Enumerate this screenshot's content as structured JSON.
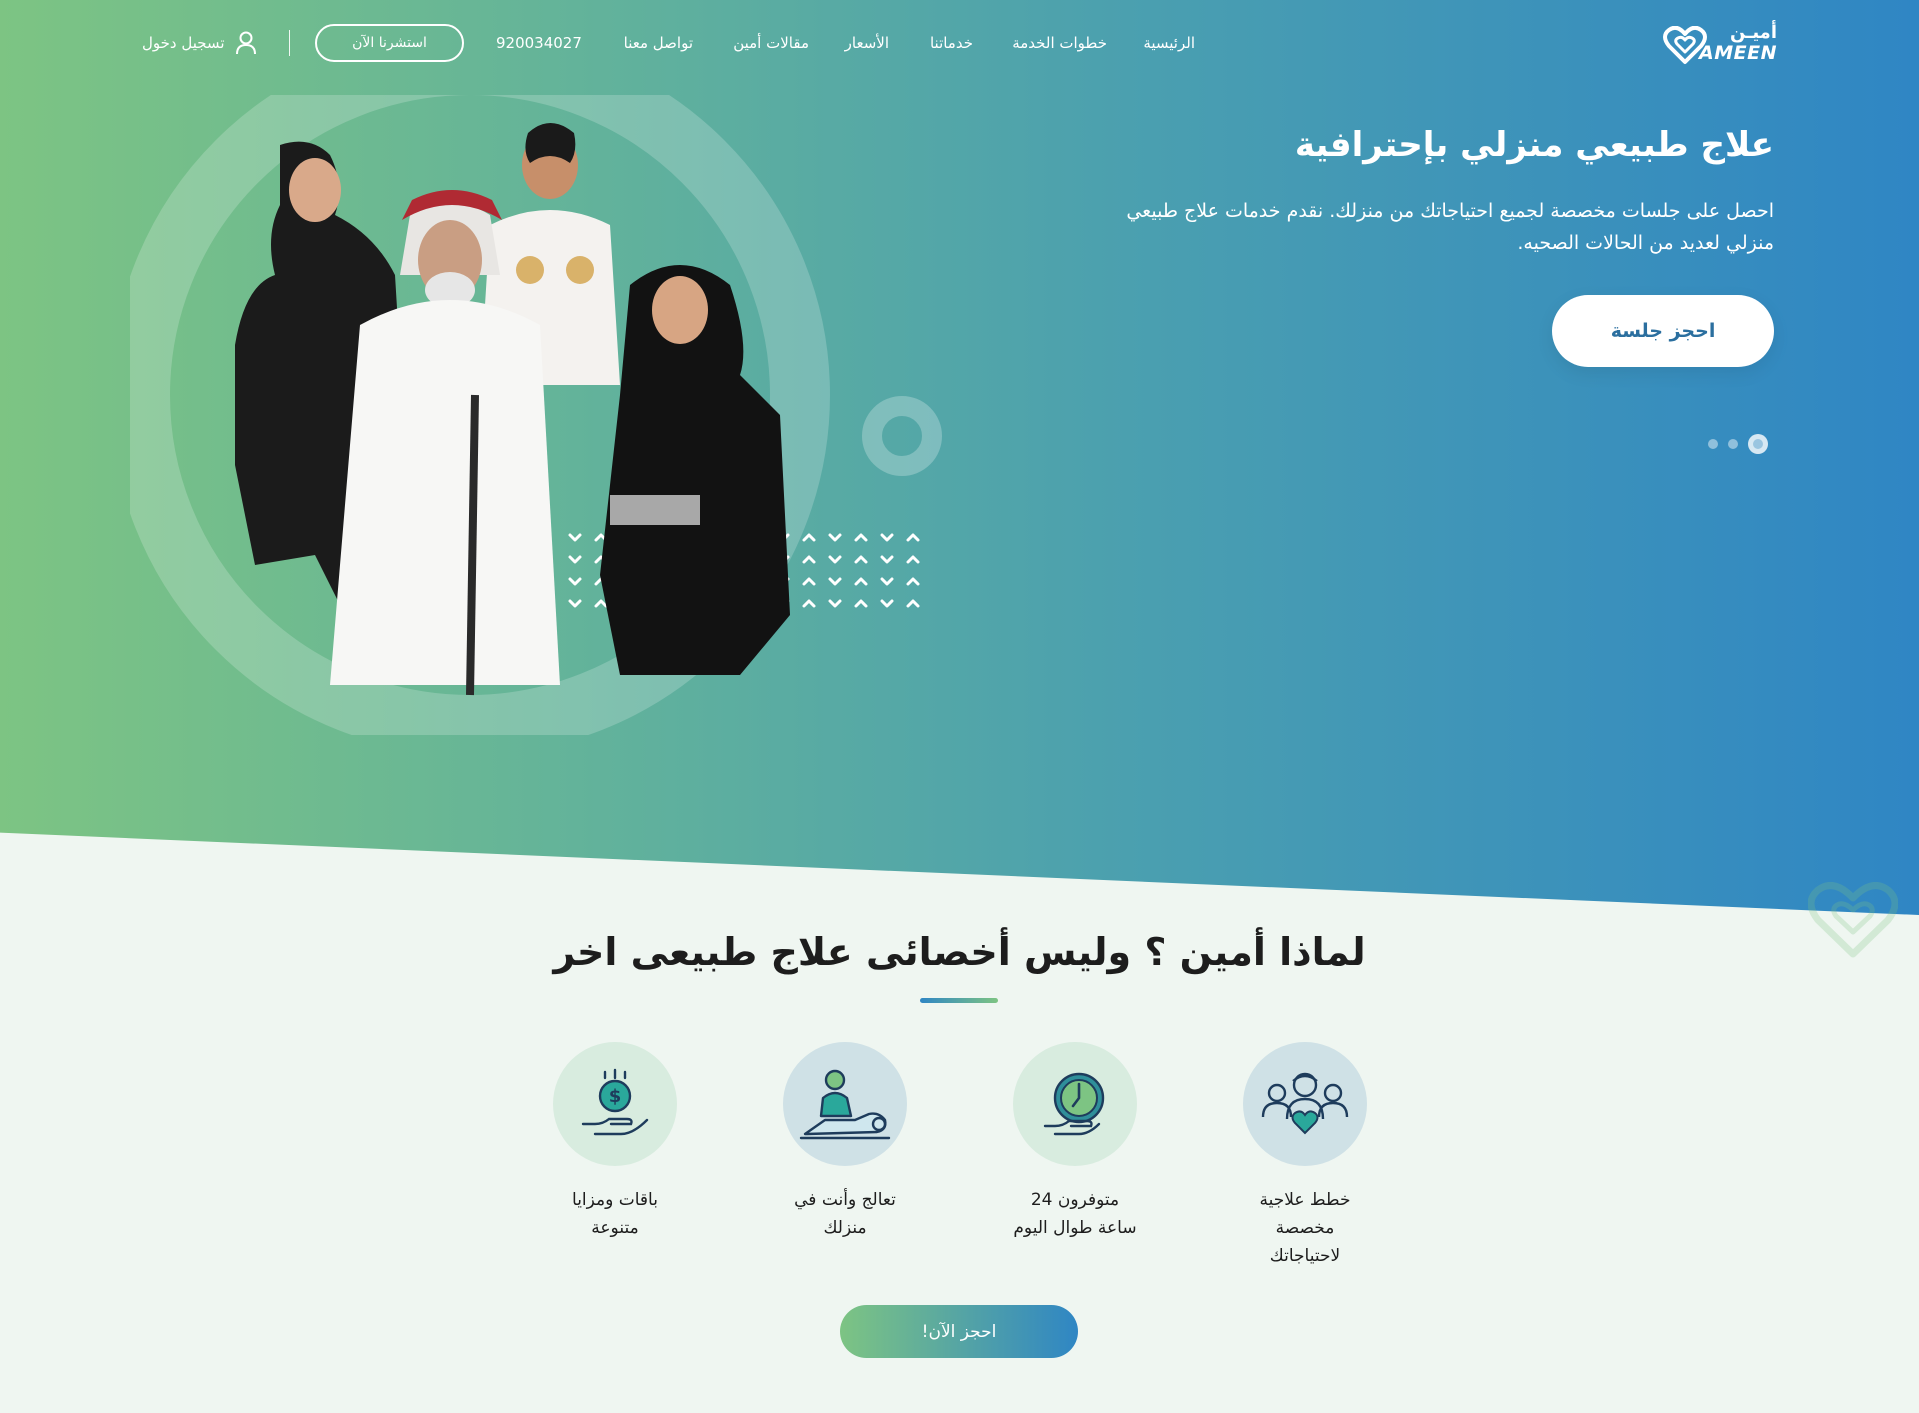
{
  "brand": {
    "name_ar": "أميـن",
    "name_en": "AMEEN"
  },
  "nav": {
    "links": [
      {
        "label": "الرئيسية"
      },
      {
        "label": "خطوات الخدمة"
      },
      {
        "label": "خدماتنا"
      },
      {
        "label": "الأسعار"
      },
      {
        "label": "مقالات أمين"
      },
      {
        "label": "تواصل معنا"
      }
    ],
    "phone": "920034027",
    "consult_label": "استشرنا الآن",
    "login_label": "تسجيل دخول"
  },
  "hero": {
    "title": "علاج طبيعي منزلي بإحترافية",
    "description": "احصل على جلسات مخصصة لجميع احتياجاتك من منزلك. نقدم خدمات علاج طبيعي منزلي لعديد من الحالات الصحيه.",
    "cta_label": "احجز جلسة",
    "slide_count": 3,
    "active_slide": 1
  },
  "why": {
    "title": "لماذا أمين ؟ وليس أخصائى علاج طبيعى اخر",
    "features": [
      {
        "label": "خطط علاجية مخصصة لاحتياجاتك",
        "icon": "team-heart-icon"
      },
      {
        "label": "متوفرون 24 ساعة طوال اليوم",
        "icon": "clock-hand-icon"
      },
      {
        "label": "تعالج وأنت في منزلك",
        "icon": "therapist-patient-icon"
      },
      {
        "label": "باقات ومزايا متنوعة",
        "icon": "money-hand-icon"
      }
    ],
    "cta_label": "احجز الآن!"
  },
  "colors": {
    "green": "#7dc483",
    "blue": "#2f86c4",
    "teal": "#1e8a80",
    "dark_blue": "#1e3c5c"
  }
}
